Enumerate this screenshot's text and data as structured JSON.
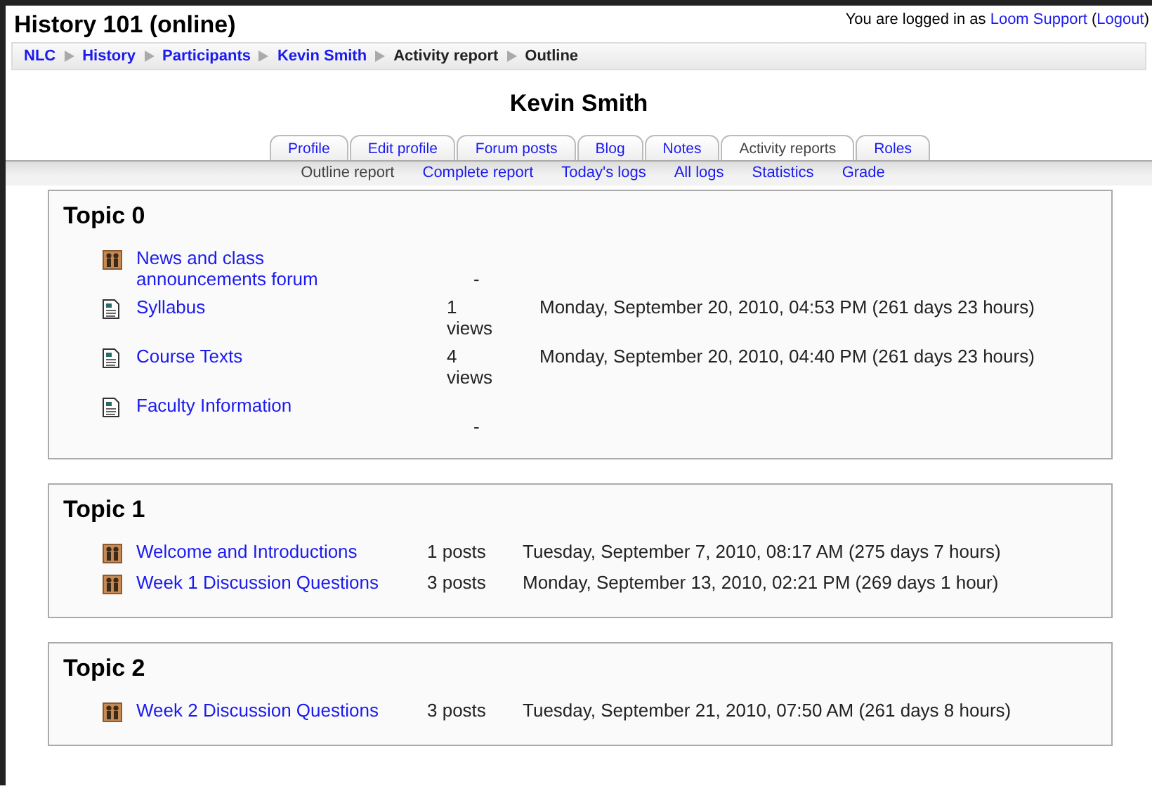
{
  "header": {
    "title": "History 101 (online)",
    "login_text": "You are logged in as",
    "user": "Loom Support",
    "open_paren": "(",
    "logout": "Logout",
    "close_paren": ")"
  },
  "breadcrumb": [
    {
      "label": "NLC",
      "link": true
    },
    {
      "label": "History",
      "link": true
    },
    {
      "label": "Participants",
      "link": true
    },
    {
      "label": "Kevin Smith",
      "link": true
    },
    {
      "label": "Activity report",
      "link": false
    },
    {
      "label": "Outline",
      "link": false
    }
  ],
  "heading": "Kevin Smith",
  "tabs": [
    {
      "label": "Profile",
      "selected": false
    },
    {
      "label": "Edit profile",
      "selected": false
    },
    {
      "label": "Forum posts",
      "selected": false
    },
    {
      "label": "Blog",
      "selected": false
    },
    {
      "label": "Notes",
      "selected": false
    },
    {
      "label": "Activity reports",
      "selected": true
    },
    {
      "label": "Roles",
      "selected": false
    }
  ],
  "subtabs": [
    {
      "label": "Outline report",
      "selected": true
    },
    {
      "label": "Complete report",
      "selected": false
    },
    {
      "label": "Today's logs",
      "selected": false
    },
    {
      "label": "All logs",
      "selected": false
    },
    {
      "label": "Statistics",
      "selected": false
    },
    {
      "label": "Grade",
      "selected": false
    }
  ],
  "topics": [
    {
      "title": "Topic 0",
      "items": [
        {
          "kind": "forum",
          "name": "News and class announcements forum",
          "count": "-"
        },
        {
          "kind": "page",
          "name": "Syllabus",
          "count": "1 views",
          "last_access": "Monday, September 20, 2010, 04:53 PM (261 days 23 hours)"
        },
        {
          "kind": "page",
          "name": "Course Texts",
          "count": "4 views",
          "last_access": "Monday, September 20, 2010, 04:40 PM (261 days 23 hours)"
        },
        {
          "kind": "page",
          "name": "Faculty Information",
          "count": "-"
        }
      ]
    },
    {
      "title": "Topic 1",
      "items": [
        {
          "kind": "forum",
          "name": "Welcome and Introductions",
          "count": "1 posts",
          "last_access": "Tuesday, September 7, 2010, 08:17 AM (275 days 7 hours)"
        },
        {
          "kind": "forum",
          "name": "Week 1 Discussion Questions",
          "count": "3 posts",
          "last_access": "Monday, September 13, 2010, 02:21 PM (269 days 1 hour)"
        }
      ]
    },
    {
      "title": "Topic 2",
      "items": [
        {
          "kind": "forum",
          "name": "Week 2 Discussion Questions",
          "count": "3 posts",
          "last_access": "Tuesday, September 21, 2010, 07:50 AM (261 days 8 hours)"
        }
      ]
    }
  ]
}
